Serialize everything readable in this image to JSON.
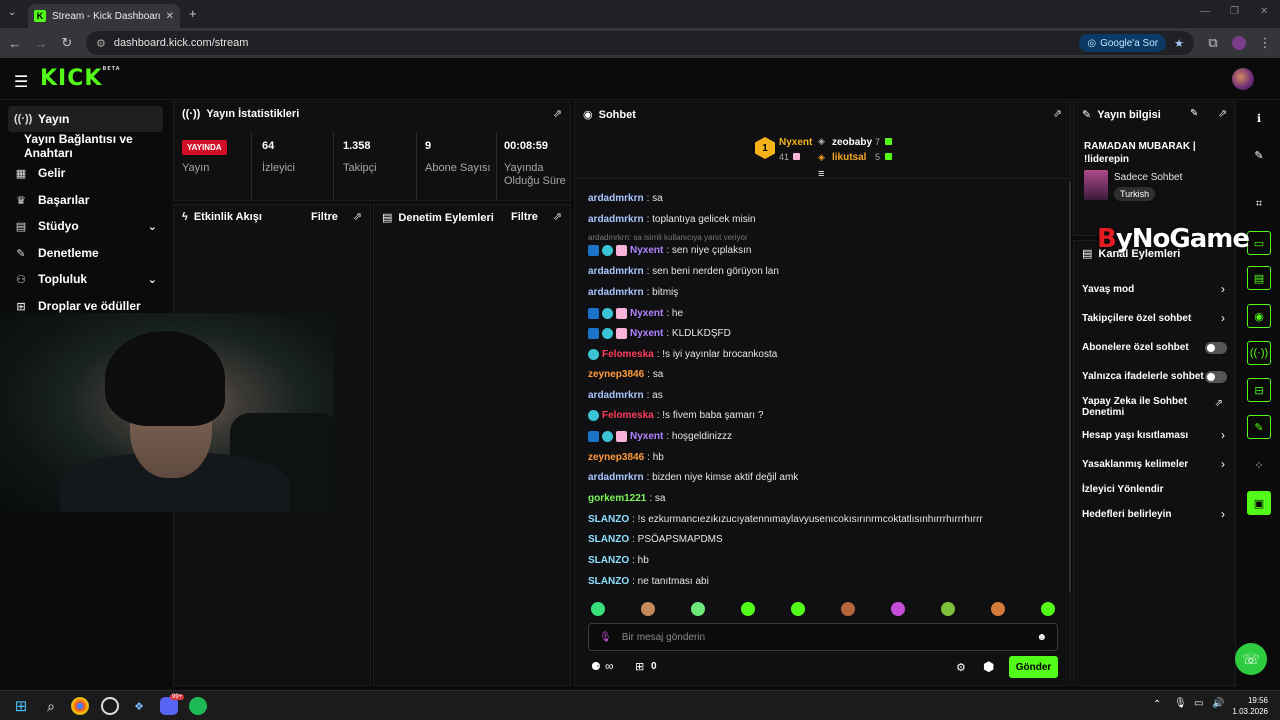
{
  "browser": {
    "tab_title": "Stream - Kick Dashboard",
    "url": "dashboard.kick.com/stream",
    "ask_label": "Google'a Sor"
  },
  "kick": {
    "logo": "KICK",
    "beta": "BETA"
  },
  "sidebar": {
    "items": [
      {
        "label": "Yayın",
        "icon": "broadcast-icon"
      },
      {
        "label": "Yayın Bağlantısı ve Anahtarı"
      },
      {
        "label": "Gelir",
        "icon": "chart-icon"
      },
      {
        "label": "Başarılar",
        "icon": "trophy-icon"
      },
      {
        "label": "Stüdyo",
        "icon": "studio-icon"
      },
      {
        "label": "Denetleme",
        "icon": "wrench-icon"
      },
      {
        "label": "Topluluk",
        "icon": "people-icon"
      },
      {
        "label": "Droplar ve ödüller",
        "icon": "gift-icon"
      }
    ]
  },
  "stats": {
    "title": "Yayın İstatistikleri",
    "live_badge": "YAYINDA",
    "live_label": "Yayın",
    "viewers": {
      "value": "64",
      "label": "İzleyici"
    },
    "followers": {
      "value": "1.358",
      "label": "Takipçi"
    },
    "subs": {
      "value": "9",
      "label": "Abone Sayısı"
    },
    "uptime": {
      "value": "00:08:59",
      "label": "Yayında Olduğu Süre"
    }
  },
  "activity": {
    "title": "Etkinlik Akışı",
    "filter": "Filtre"
  },
  "moderation": {
    "title": "Denetim Eylemleri",
    "filter": "Filtre"
  },
  "chat": {
    "title": "Sohbet",
    "leaders": {
      "first_rank": "1",
      "first_name": "Nyxent",
      "first_count": "41",
      "second_name": "zeobaby",
      "second_count": "7",
      "third_name": "likutsal",
      "third_count": "5"
    },
    "reply_note": "ardadmrkrn: sa isimli kullanıcıya yanıt veriyor",
    "messages": [
      {
        "user": "ardadmrkrn",
        "color": "#a9c7ff",
        "text": ": sa",
        "badges": 0
      },
      {
        "user": "ardadmrkrn",
        "color": "#a9c7ff",
        "text": ": toplantıya gelicek misin",
        "badges": 0
      },
      {
        "user": "Nyxent",
        "color": "#b084ff",
        "text": ": sen niye çıplaksın",
        "badges": 3
      },
      {
        "user": "ardadmrkrn",
        "color": "#a9c7ff",
        "text": ": sen beni nerden görüyon lan",
        "badges": 0
      },
      {
        "user": "ardadmrkrn",
        "color": "#a9c7ff",
        "text": ": bitmiş",
        "badges": 0
      },
      {
        "user": "Nyxent",
        "color": "#b084ff",
        "text": ": he",
        "badges": 3
      },
      {
        "user": "Nyxent",
        "color": "#b084ff",
        "text": ": KLDLKDŞFD",
        "badges": 3
      },
      {
        "user": "Felomeska",
        "color": "#ff3c5a",
        "text": ": !s iyi yayınlar brocankosta",
        "badges": 1
      },
      {
        "user": "zeynep3846",
        "color": "#ff9a3c",
        "text": ": sa",
        "badges": 0
      },
      {
        "user": "ardadmrkrn",
        "color": "#a9c7ff",
        "text": ": as",
        "badges": 0
      },
      {
        "user": "Felomeska",
        "color": "#ff3c5a",
        "text": ": !s fivem baba şamarı ?",
        "badges": 1
      },
      {
        "user": "Nyxent",
        "color": "#b084ff",
        "text": ": hoşgeldinizzz",
        "badges": 3
      },
      {
        "user": "zeynep3846",
        "color": "#ff9a3c",
        "text": ": hb",
        "badges": 0
      },
      {
        "user": "ardadmrkrn",
        "color": "#a9c7ff",
        "text": ": bizden niye kimse aktif değil amk",
        "badges": 0
      },
      {
        "user": "gorkem1221",
        "color": "#7cf55a",
        "text": ": sa",
        "badges": 0
      },
      {
        "user": "SLANZO",
        "color": "#8fe0ff",
        "text": ": !s ezkurmancıezıkızucıyatennımaylavyusenıcokısırınrmcoktatlısınhırrrhırrrhırrr",
        "badges": 0
      },
      {
        "user": "SLANZO",
        "color": "#8fe0ff",
        "text": ": PSÖAPSMAPDMS",
        "badges": 0
      },
      {
        "user": "SLANZO",
        "color": "#8fe0ff",
        "text": ": hb",
        "badges": 0
      },
      {
        "user": "SLANZO",
        "color": "#8fe0ff",
        "text": ": ne tanıtması abi",
        "badges": 0
      }
    ],
    "input_placeholder": "Bir mesaj gönderin",
    "infinity": "∞",
    "gift_count": "0",
    "send": "Gönder"
  },
  "info": {
    "title": "Yayın bilgisi",
    "stream_title": "RAMADAN MUBARAK | !liderepin",
    "category": "Sadece Sohbet",
    "tag": "Turkish"
  },
  "channel_actions": {
    "title": "Kanal Eylemleri",
    "items": [
      {
        "label": "Yavaş mod",
        "kind": "chevron"
      },
      {
        "label": "Takipçilere özel sohbet",
        "kind": "chevron"
      },
      {
        "label": "Abonelere özel sohbet",
        "kind": "toggle"
      },
      {
        "label": "Yalnızca ifadelerle sohbet",
        "kind": "toggle"
      },
      {
        "label": "Yapay Zeka ile Sohbet Denetimi",
        "kind": "external"
      },
      {
        "label": "Hesap yaşı kısıtlaması",
        "kind": "chevron"
      },
      {
        "label": "Yasaklanmış kelimeler",
        "kind": "chevron"
      },
      {
        "label": "İzleyici Yönlendir",
        "kind": "none"
      },
      {
        "label": "Hedefleri belirleyin",
        "kind": "chevron"
      }
    ]
  },
  "watermark": {
    "prefix": "B",
    "rest": "yNoGame"
  },
  "taskbar": {
    "time": "19:56",
    "date": "1.03.2026",
    "badge": "99+"
  }
}
